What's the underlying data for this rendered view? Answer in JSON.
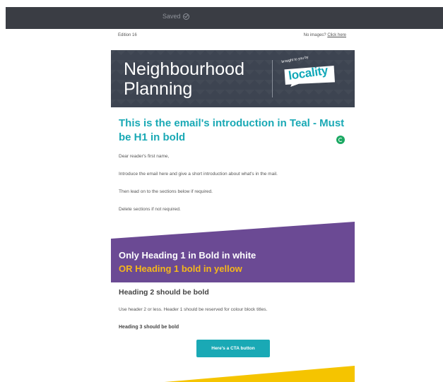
{
  "toolbar": {
    "status": "Saved",
    "status_icon": "check-circle-icon"
  },
  "preheader": {
    "edition": "Edition 16",
    "no_images_text": "No images?",
    "click_here": "Click here"
  },
  "banner": {
    "title_line1": "Neighbourhood",
    "title_line2": "Planning",
    "brought_to_you_by": "brought to you by",
    "logo_text": "locality"
  },
  "intro": {
    "heading": "This is the email's introduction in Teal - Must be H1 in bold",
    "greeting": "Dear reader's first name,",
    "paragraph1": "Introduce the email here and give a short introduction about what's in the mail.",
    "paragraph2": "Then lead on to the sections below if required.",
    "paragraph3": "Delete sections if not required."
  },
  "purple_block": {
    "heading_white": "Only Heading 1 in Bold in white",
    "heading_yellow": "OR Heading 1 bold in yellow"
  },
  "content": {
    "heading2": "Heading 2 should be bold",
    "body": "Use header 2 or less. Header 1 should be reserved for colour block titles.",
    "heading3": "Heading 3 should be bold",
    "cta_label": "Here's a CTA button"
  },
  "colors": {
    "teal": "#1aa9b5",
    "purple": "#6b4a94",
    "yellow": "#f5b71b",
    "banner_bg": "#3d4451",
    "toolbar_bg": "#3a3d44"
  }
}
